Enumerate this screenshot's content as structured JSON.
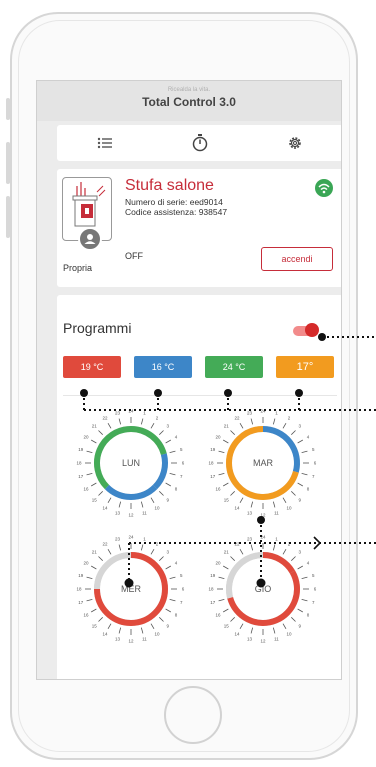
{
  "app": {
    "tagline": "Ricealda la vita.",
    "title": "Total Control 3.0"
  },
  "tabs": [
    {
      "name": "list-icon"
    },
    {
      "name": "timer-icon"
    },
    {
      "name": "gear-icon"
    }
  ],
  "device": {
    "name": "Stufa salone",
    "serial": "Numero di serie: eed9014",
    "assistance": "Codice assistenza: 938547",
    "owner": "Propria",
    "status": "OFF",
    "action": "accendi",
    "wifi_icon": "wifi-icon"
  },
  "programs": {
    "title": "Programmi",
    "toggle_on": true,
    "temps": [
      {
        "label": "19 °C",
        "color": "#e04a3c"
      },
      {
        "label": "16 °C",
        "color": "#3d86c8"
      },
      {
        "label": "24 °C",
        "color": "#44ab57"
      },
      {
        "label": "17°",
        "color": "#f29b1f"
      }
    ],
    "days": [
      {
        "label": "LUN"
      },
      {
        "label": "MAR"
      },
      {
        "label": "MER"
      },
      {
        "label": "GIO"
      }
    ],
    "hour_labels": [
      "24",
      "1",
      "2",
      "3",
      "4",
      "5",
      "6",
      "7",
      "8",
      "9",
      "10",
      "11",
      "12",
      "13",
      "14",
      "15",
      "16",
      "17",
      "18",
      "19",
      "20",
      "21",
      "22",
      "23"
    ]
  },
  "colors": {
    "accent": "#c62d3a",
    "green": "#44ab57",
    "blue": "#3d86c8",
    "orange": "#f29b1f",
    "red": "#e04a3c"
  }
}
